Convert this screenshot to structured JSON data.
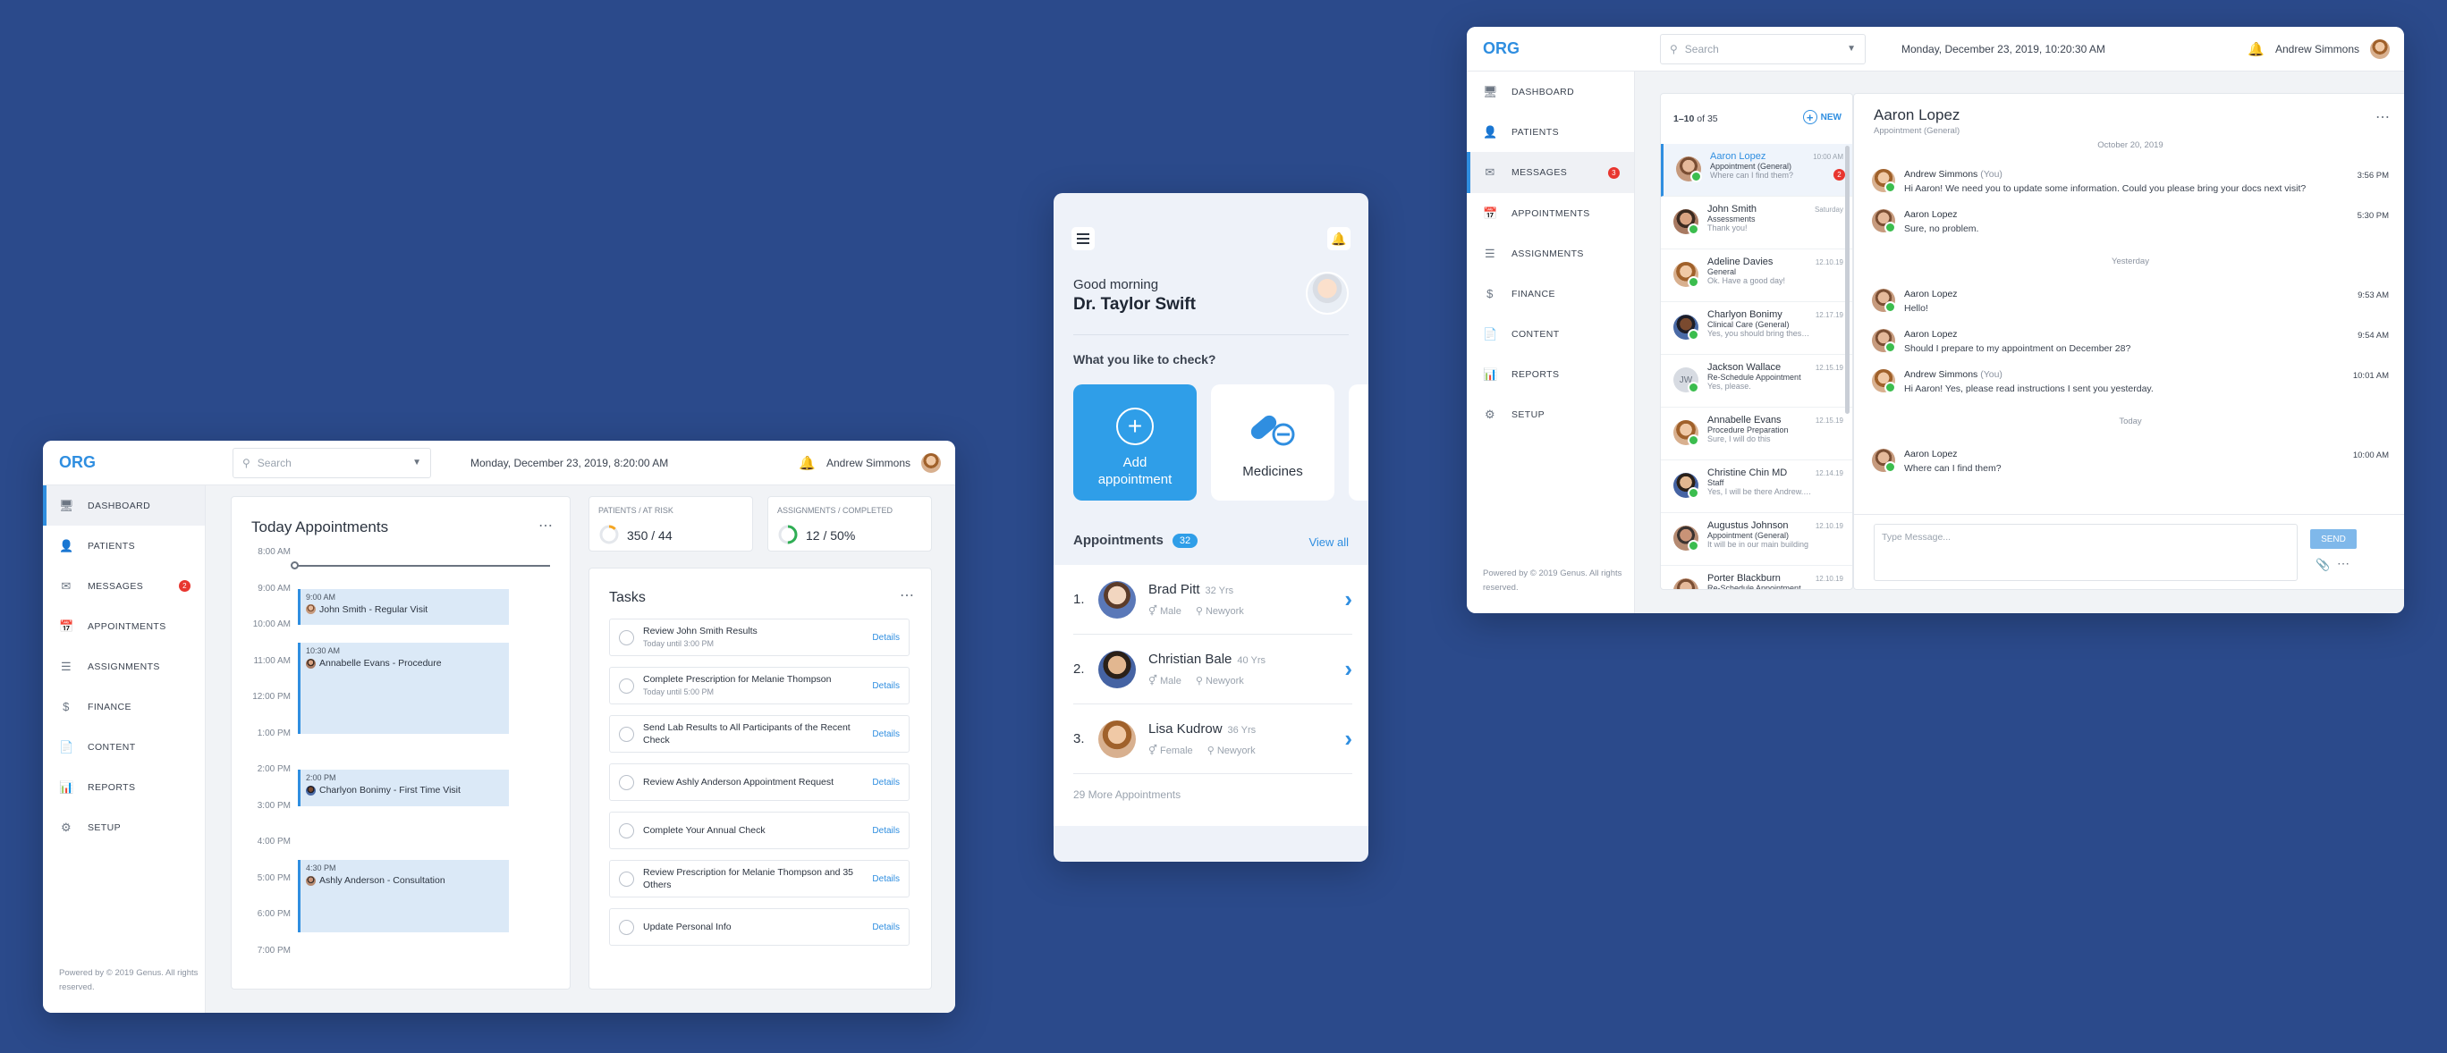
{
  "dashboard": {
    "logo": "ORG",
    "search_placeholder": "Search",
    "date": "Monday, December 23, 2019, 8:20:00 AM",
    "user": "Andrew Simmons",
    "nav": [
      {
        "label": "DASHBOARD",
        "icon": "monitor-icon"
      },
      {
        "label": "PATIENTS",
        "icon": "person-icon"
      },
      {
        "label": "MESSAGES",
        "icon": "message-icon",
        "badge": "2"
      },
      {
        "label": "APPOINTMENTS",
        "icon": "calendar-icon"
      },
      {
        "label": "ASSIGNMENTS",
        "icon": "list-icon"
      },
      {
        "label": "FINANCE",
        "icon": "dollar-icon"
      },
      {
        "label": "CONTENT",
        "icon": "document-icon"
      },
      {
        "label": "REPORTS",
        "icon": "bar-chart-icon"
      },
      {
        "label": "SETUP",
        "icon": "gear-icon"
      }
    ],
    "footer": "Powered by © 2019 Genus. All rights reserved.",
    "today": {
      "title": "Today Appointments",
      "times": [
        "8:00 AM",
        "9:00 AM",
        "10:00 AM",
        "11:00 AM",
        "12:00 PM",
        "1:00 PM",
        "2:00 PM",
        "3:00 PM",
        "4:00 PM",
        "5:00 PM",
        "6:00 PM",
        "7:00 PM"
      ],
      "appointments": [
        {
          "time": "9:00 AM",
          "name": "John Smith - Regular Visit"
        },
        {
          "time": "10:30 AM",
          "name": "Annabelle Evans - Procedure"
        },
        {
          "time": "2:00 PM",
          "name": "Charlyon Bonimy - First Time Visit"
        },
        {
          "time": "4:30 PM",
          "name": "Ashly Anderson - Consultation"
        }
      ]
    },
    "stats": [
      {
        "label": "PATIENTS / AT RISK",
        "value": "350 / 44",
        "ring_fraction": 0.13
      },
      {
        "label": "ASSIGNMENTS / COMPLETED",
        "value": "12 / 50%",
        "ring_fraction": 0.5
      }
    ],
    "tasks": {
      "title": "Tasks",
      "details_label": "Details",
      "items": [
        {
          "title": "Review John Smith Results",
          "sub": "Today until 3:00 PM"
        },
        {
          "title": "Complete Prescription for Melanie Thompson",
          "sub": "Today until 5:00 PM"
        },
        {
          "title": "Send Lab Results to All Participants of the Recent Check",
          "sub": ""
        },
        {
          "title": "Review Ashly Anderson Appointment Request",
          "sub": ""
        },
        {
          "title": "Complete Your Annual Check",
          "sub": ""
        },
        {
          "title": "Review Prescription for Melanie Thompson and 35 Others",
          "sub": ""
        },
        {
          "title": "Update Personal Info",
          "sub": ""
        }
      ]
    }
  },
  "mobile": {
    "greeting": "Good morning",
    "doctor": "Dr. Taylor Swift",
    "question": "What you like to check?",
    "tiles": [
      {
        "label": "Add appointment",
        "icon": "plus-circle-icon"
      },
      {
        "label": "Medicines",
        "icon": "pill-icon"
      }
    ],
    "appointments_title": "Appointments",
    "appointments_count": "32",
    "view_all": "View all",
    "patients": [
      {
        "num": "1.",
        "name": "Brad Pitt",
        "age": "32 Yrs",
        "gender": "Male",
        "city": "Newyork"
      },
      {
        "num": "2.",
        "name": "Christian Bale",
        "age": "40 Yrs",
        "gender": "Male",
        "city": "Newyork"
      },
      {
        "num": "3.",
        "name": "Lisa Kudrow",
        "age": "36 Yrs",
        "gender": "Female",
        "city": "Newyork"
      }
    ],
    "more": "29 More Appointments"
  },
  "messages": {
    "logo": "ORG",
    "search_placeholder": "Search",
    "date": "Monday, December 23, 2019, 10:20:30 AM",
    "user": "Andrew Simmons",
    "nav": [
      {
        "label": "DASHBOARD",
        "icon": "monitor-icon"
      },
      {
        "label": "PATIENTS",
        "icon": "person-icon"
      },
      {
        "label": "MESSAGES",
        "icon": "message-icon",
        "badge": "3"
      },
      {
        "label": "APPOINTMENTS",
        "icon": "calendar-icon"
      },
      {
        "label": "ASSIGNMENTS",
        "icon": "list-icon"
      },
      {
        "label": "FINANCE",
        "icon": "dollar-icon"
      },
      {
        "label": "CONTENT",
        "icon": "document-icon"
      },
      {
        "label": "REPORTS",
        "icon": "bar-chart-icon"
      },
      {
        "label": "SETUP",
        "icon": "gear-icon"
      }
    ],
    "footer": "Powered by © 2019 Genus. All rights reserved.",
    "list_count_bold": "1–10",
    "list_count_rest": "of 35",
    "new_label": "NEW",
    "conversations": [
      {
        "name": "Aaron Lopez",
        "sub": "Appointment (General)",
        "preview": "Where can I find them?",
        "time": "10:00 AM",
        "badge": "2"
      },
      {
        "name": "John Smith",
        "sub": "Assessments",
        "preview": "Thank you!",
        "time": "Saturday"
      },
      {
        "name": "Adeline Davies",
        "sub": "General",
        "preview": "Ok. Have a good day!",
        "time": "12.10.19"
      },
      {
        "name": "Charlyon Bonimy",
        "sub": "Clinical Care (General)",
        "preview": "Yes, you should bring these documents",
        "time": "12.17.19"
      },
      {
        "name": "Jackson Wallace",
        "sub": "Re-Schedule Appointment",
        "preview": "Yes, please.",
        "time": "12.15.19",
        "initials": "JW"
      },
      {
        "name": "Annabelle Evans",
        "sub": "Procedure Preparation",
        "preview": "Sure, I will do this",
        "time": "12.15.19"
      },
      {
        "name": "Christine Chin MD",
        "sub": "Staff",
        "preview": "Yes, I will be there Andrew. See you",
        "time": "12.14.19"
      },
      {
        "name": "Augustus Johnson",
        "sub": "Appointment (General)",
        "preview": "It will be in our main building",
        "time": "12.10.19"
      },
      {
        "name": "Porter Blackburn",
        "sub": "Re-Schedule Appointment",
        "preview": "",
        "time": "12.10.19"
      }
    ],
    "chat": {
      "name": "Aaron Lopez",
      "sub": "Appointment (General)",
      "top_date": "October 20, 2019",
      "items": [
        {
          "type": "msg",
          "name": "Andrew Simmons",
          "you": "(You)",
          "text": "Hi Aaron! We need you to update some information. Could you please bring your docs next visit?",
          "time": "3:56 PM"
        },
        {
          "type": "msg",
          "name": "Aaron Lopez",
          "text": "Sure, no problem.",
          "time": "5:30 PM"
        },
        {
          "type": "day",
          "text": "Yesterday"
        },
        {
          "type": "msg",
          "name": "Aaron Lopez",
          "text": "Hello!",
          "time": "9:53 AM"
        },
        {
          "type": "msg",
          "name": "Aaron Lopez",
          "text": "Should I prepare to my appointment on December 28?",
          "time": "9:54 AM"
        },
        {
          "type": "msg",
          "name": "Andrew Simmons",
          "you": "(You)",
          "text": "Hi Aaron! Yes, please read instructions I sent you yesterday.",
          "time": "10:01 AM"
        },
        {
          "type": "day",
          "text": "Today"
        },
        {
          "type": "msg",
          "name": "Aaron Lopez",
          "text": "Where can I find them?",
          "time": "10:00 AM"
        }
      ],
      "input_placeholder": "Type Message...",
      "send_label": "SEND"
    }
  }
}
